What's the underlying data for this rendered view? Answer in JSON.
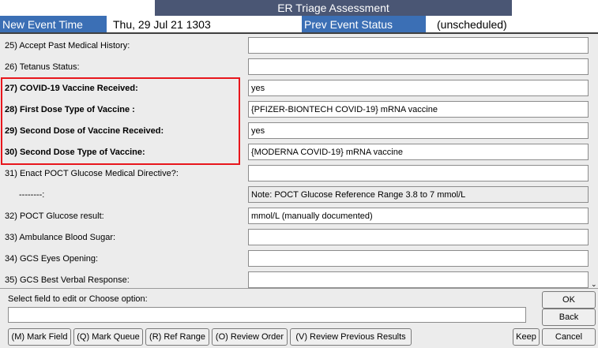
{
  "window": {
    "title": "ER Triage Assessment"
  },
  "header": {
    "new_event_label": "New Event Time",
    "new_event_value": "Thu, 29 Jul 21  1303",
    "prev_event_label": "Prev Event Status",
    "prev_event_value": "(unscheduled)"
  },
  "rows": [
    {
      "label": "25)  Accept Past Medical History:",
      "value": ""
    },
    {
      "label": "26)  Tetanus Status:",
      "value": ""
    },
    {
      "label": "27)  COVID-19 Vaccine Received:",
      "value": "yes"
    },
    {
      "label": "28)  First Dose Type of Vaccine :",
      "value": "{PFIZER-BIONTECH COVID-19} mRNA vaccine"
    },
    {
      "label": "29)  Second Dose of Vaccine Received:",
      "value": "yes"
    },
    {
      "label": "30)  Second Dose Type of Vaccine:",
      "value": "{MODERNA COVID-19} mRNA vaccine"
    },
    {
      "label": "31)  Enact POCT Glucose Medical Directive?:",
      "value": ""
    },
    {
      "label": "--------:",
      "value": "Note:  POCT Glucose Reference Range 3.8 to 7 mmol/L"
    },
    {
      "label": "32)  POCT Glucose result:",
      "value": "mmol/L (manually documented)"
    },
    {
      "label": "33)  Ambulance Blood Sugar:",
      "value": ""
    },
    {
      "label": "34)  GCS Eyes Opening:",
      "value": ""
    },
    {
      "label": "35)  GCS Best Verbal Response:",
      "value": ""
    }
  ],
  "bottom": {
    "prompt": "Select field to edit or Choose option:",
    "command_value": "",
    "buttons": {
      "ok": "OK",
      "back": "Back",
      "mark_field": "(M) Mark Field",
      "mark_queue": "(Q) Mark Queue",
      "ref_range": "(R) Ref Range",
      "review_order": "(O) Review Order",
      "review_previous": "(V) Review Previous Results",
      "keep": "Keep",
      "cancel": "Cancel"
    }
  },
  "icons": {
    "scroll_down": "chevron-down-icon"
  },
  "colors": {
    "title_bg": "#4a5674",
    "header_label_bg": "#3b6fb5",
    "highlight": "#e8161c",
    "panel_bg": "#ececec"
  }
}
